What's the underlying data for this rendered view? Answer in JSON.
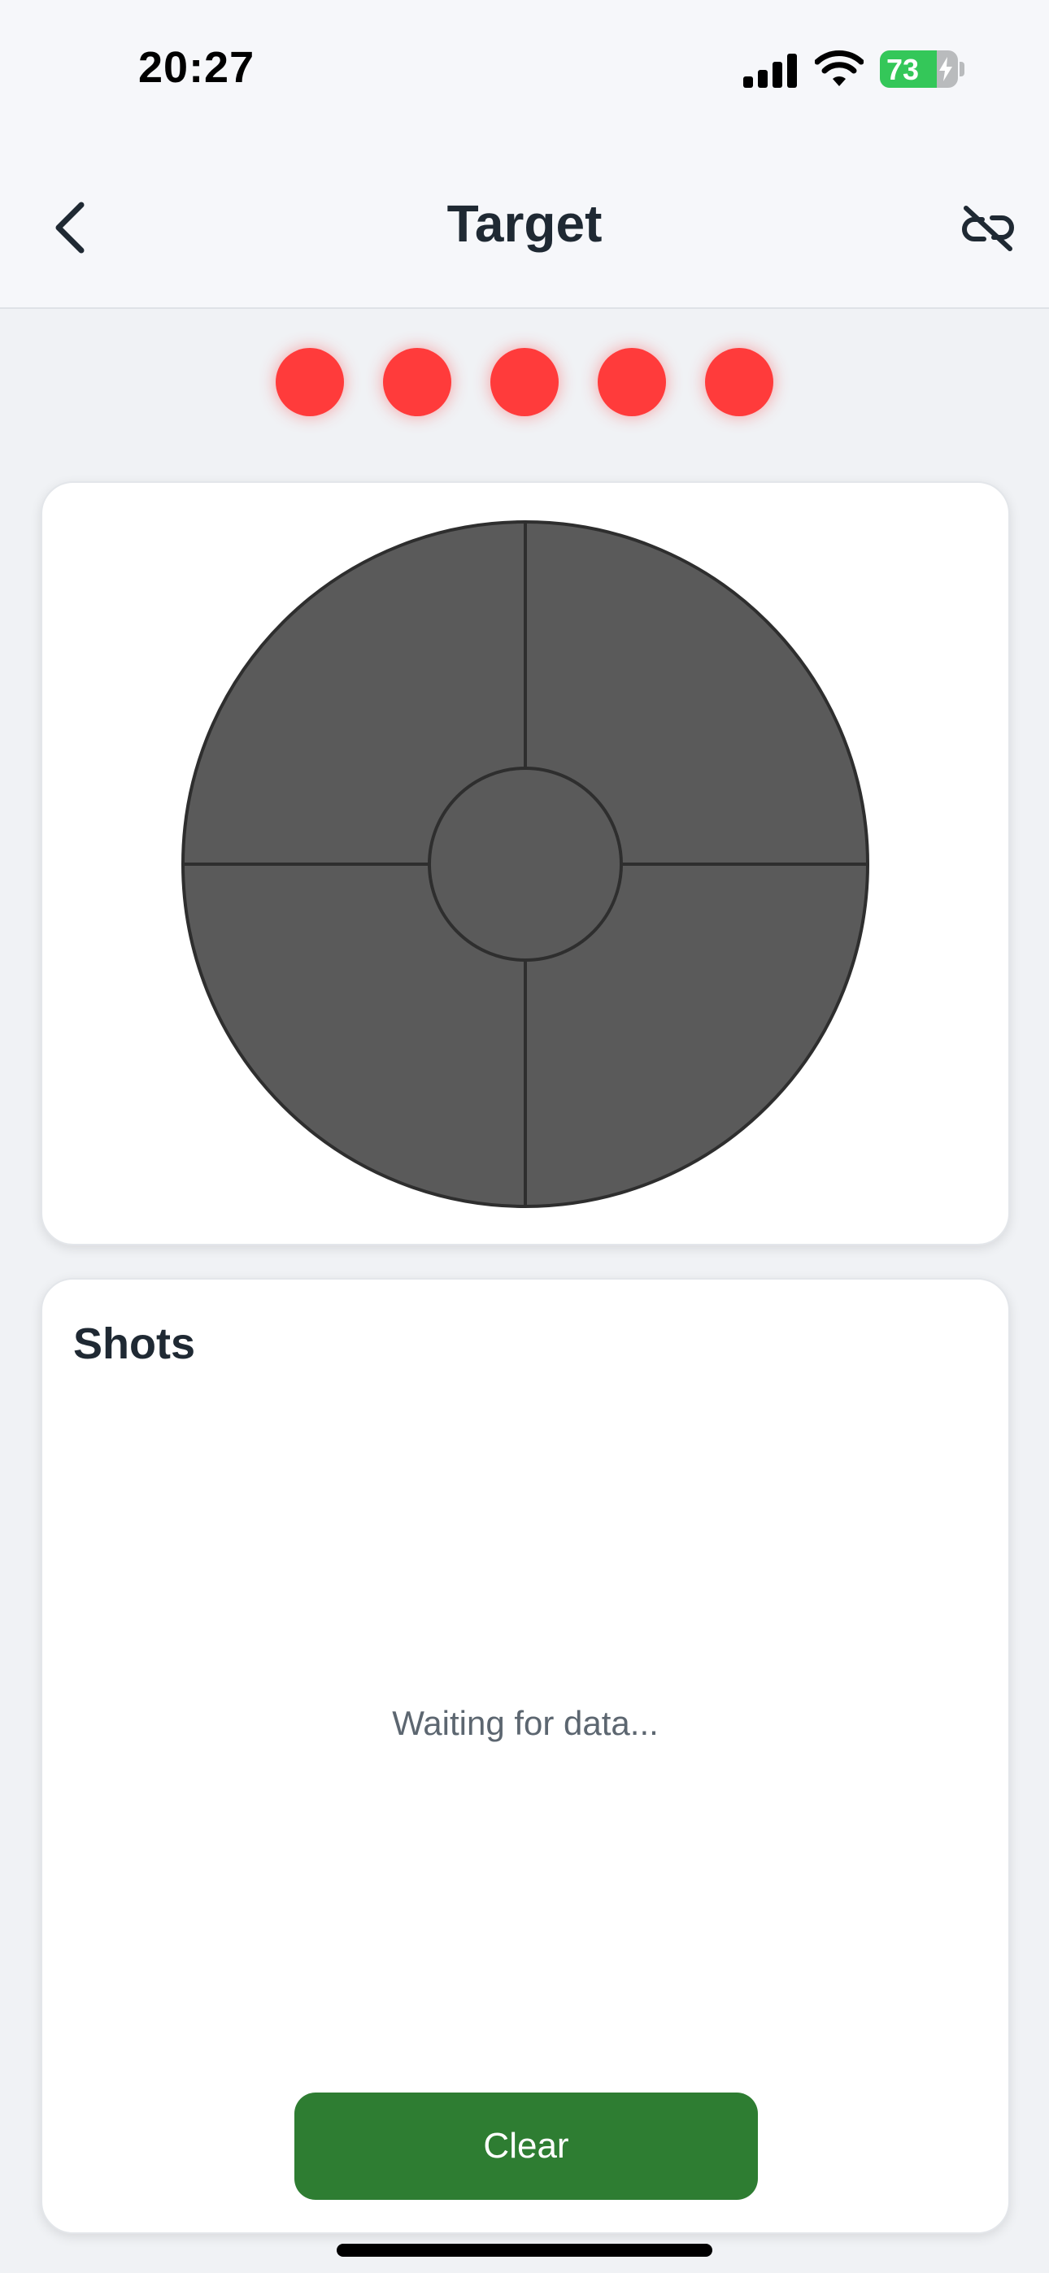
{
  "status_bar": {
    "time": "20:27",
    "battery_percent": "73",
    "battery_level": 0.73,
    "icons": [
      "signal-icon",
      "wifi-icon",
      "battery-icon",
      "charging-bolt-icon"
    ]
  },
  "header": {
    "title": "Target",
    "back_icon": "chevron-left-icon",
    "action_icon": "unlink-icon"
  },
  "indicators": {
    "count": 5,
    "color": "#ff3b3b"
  },
  "target": {
    "fill_color": "#5a5a5a",
    "stroke_color": "#2e2e2e",
    "zones": [
      "center",
      "top-left",
      "top-right",
      "bottom-left",
      "bottom-right"
    ]
  },
  "shots": {
    "title": "Shots",
    "empty_text": "Waiting for data...",
    "clear_label": "Clear",
    "clear_color": "#2e7d32"
  }
}
